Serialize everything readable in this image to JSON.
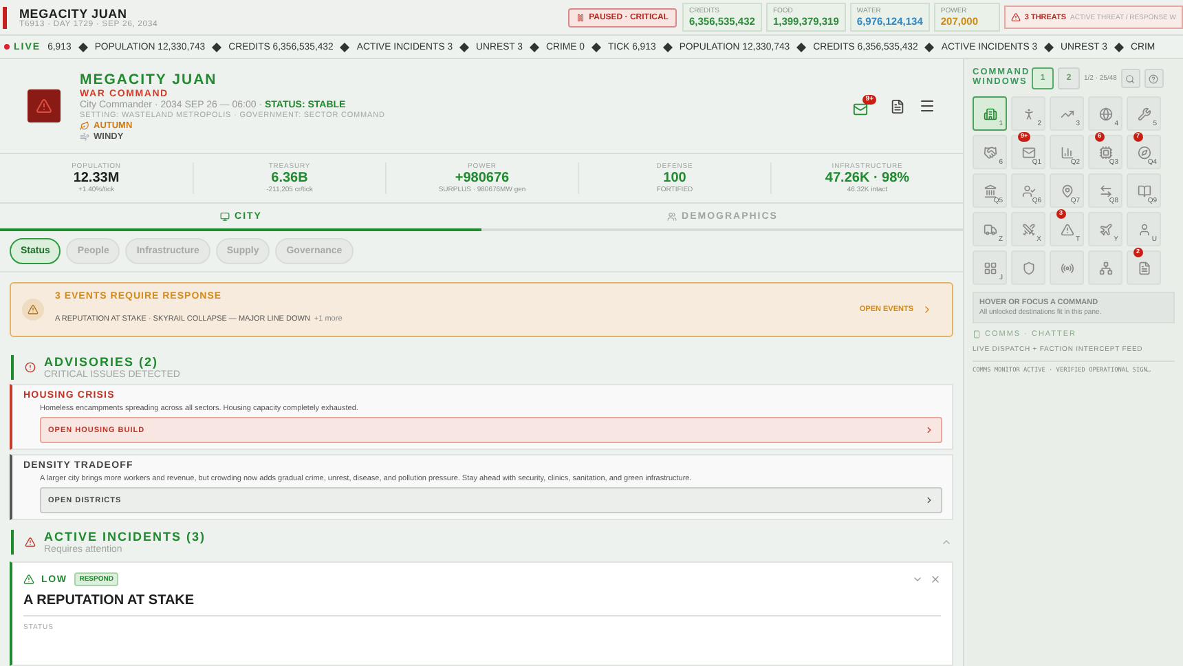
{
  "top_bar": {
    "title": "MEGACITY JUAN",
    "subtitle": "T6913 · DAY 1729 · SEP 26, 2034",
    "status": "PAUSED · CRITICAL",
    "resources": [
      {
        "label": "CREDITS",
        "value": "6,356,535,432",
        "color": "#2e8b3a"
      },
      {
        "label": "FOOD",
        "value": "1,399,379,319",
        "color": "#2e8b3a"
      },
      {
        "label": "WATER",
        "value": "6,976,124,134",
        "color": "#2f86c4"
      },
      {
        "label": "POWER",
        "value": "207,000",
        "color": "#d08a10"
      }
    ],
    "threats": {
      "label": "3 THREATS",
      "detail": "ACTIVE THREAT / RESPONSE W"
    }
  },
  "ticker": {
    "live": "LIVE",
    "items": [
      "6,913",
      "POPULATION 12,330,743",
      "CREDITS 6,356,535,432",
      "ACTIVE INCIDENTS 3",
      "UNREST 3",
      "CRIME 0",
      "TICK 6,913",
      "POPULATION 12,330,743",
      "CREDITS 6,356,535,432",
      "ACTIVE INCIDENTS 3",
      "UNREST 3",
      "CRIM"
    ]
  },
  "city": {
    "name": "MEGACITY JUAN",
    "faction": "WAR COMMAND",
    "role": "City Commander · 2034 SEP 26 — 06:00 · ",
    "status": "STATUS: STABLE",
    "setting": "SETTING: WASTELAND METROPOLIS · GOVERNMENT: SECTOR COMMAND",
    "season": "AUTUMN",
    "weather": "WINDY",
    "mail_badge": "9+"
  },
  "stats": [
    {
      "label": "POPULATION",
      "value": "12.33M",
      "sub": "+1.40%/tick",
      "color": "#1d1f1d"
    },
    {
      "label": "TREASURY",
      "value": "6.36B",
      "sub": "-211,205 cr/tick",
      "color": "#1f8a2e"
    },
    {
      "label": "POWER",
      "value": "+980676",
      "sub": "SURPLUS · 980676MW gen",
      "color": "#1f8a2e"
    },
    {
      "label": "DEFENSE",
      "value": "100",
      "sub": "FORTIFIED",
      "color": "#1f8a2e"
    },
    {
      "label": "INFRASTRUCTURE",
      "value": "47.26K · 98%",
      "sub": "46.32K intact",
      "color": "#1f8a2e"
    }
  ],
  "tabs": [
    {
      "label": "CITY",
      "selected": true
    },
    {
      "label": "DEMOGRAPHICS",
      "selected": false
    }
  ],
  "subtabs": [
    {
      "label": "Status",
      "selected": true
    },
    {
      "label": "People",
      "selected": false
    },
    {
      "label": "Infrastructure",
      "selected": false
    },
    {
      "label": "Supply",
      "selected": false
    },
    {
      "label": "Governance",
      "selected": false
    }
  ],
  "events_banner": {
    "title": "3 EVENTS REQUIRE RESPONSE",
    "detail": "A REPUTATION AT STAKE · SKYRAIL COLLAPSE — MAJOR LINE DOWN",
    "more": "+1 more",
    "action": "OPEN EVENTS"
  },
  "advisories": {
    "title": "ADVISORIES (2)",
    "subtitle": "CRITICAL ISSUES DETECTED",
    "items": [
      {
        "kind": "critical",
        "title": "HOUSING CRISIS",
        "text": "Homeless encampments spreading across all sectors. Housing capacity completely exhausted.",
        "action": "OPEN HOUSING BUILD"
      },
      {
        "kind": "info",
        "title": "DENSITY TRADEOFF",
        "text": "A larger city brings more workers and revenue, but crowding now adds gradual crime, unrest, disease, and pollution pressure. Stay ahead with security, clinics, sanitation, and green infrastructure.",
        "action": "OPEN DISTRICTS"
      }
    ]
  },
  "incidents": {
    "title": "ACTIVE INCIDENTS (3)",
    "subtitle": "Requires attention",
    "expanded": true,
    "items": [
      {
        "level": "LOW",
        "tag": "RESPOND",
        "title": "A REPUTATION AT STAKE",
        "section": "STATUS",
        "expanded": false
      }
    ]
  },
  "command_windows": {
    "title": "COMMAND WINDOWS",
    "pages": [
      {
        "label": "1",
        "selected": true
      },
      {
        "label": "2",
        "selected": false
      }
    ],
    "count": "1/2 · 25/48",
    "cells": [
      {
        "key": "1",
        "selected": true
      },
      {
        "key": "2",
        "selected": false
      },
      {
        "key": "3",
        "selected": false
      },
      {
        "key": "4",
        "selected": false
      },
      {
        "key": "5",
        "selected": false
      },
      {
        "key": "6",
        "selected": false
      },
      {
        "key": "Q1",
        "selected": false,
        "badge": "9+"
      },
      {
        "key": "Q2",
        "selected": false
      },
      {
        "key": "Q3",
        "selected": false,
        "badge": "6"
      },
      {
        "key": "Q4",
        "selected": false,
        "badge": "7"
      },
      {
        "key": "Q5",
        "selected": false
      },
      {
        "key": "Q6",
        "selected": false
      },
      {
        "key": "Q7",
        "selected": false
      },
      {
        "key": "Q8",
        "selected": false
      },
      {
        "key": "Q9",
        "selected": false
      },
      {
        "key": "Z",
        "selected": false
      },
      {
        "key": "X",
        "selected": false
      },
      {
        "key": "T",
        "selected": false,
        "badge": "3"
      },
      {
        "key": "Y",
        "selected": false
      },
      {
        "key": "U",
        "selected": false
      },
      {
        "key": "J",
        "selected": false
      },
      {
        "selected": false
      },
      {
        "selected": false
      },
      {
        "selected": false
      },
      {
        "selected": false,
        "badge": "2"
      }
    ],
    "hint_title": "HOVER OR FOCUS A COMMAND",
    "hint_text": "All unlocked destinations fit in this pane."
  },
  "comms": {
    "title": "COMMS · CHATTER",
    "subtitle": "LIVE DISPATCH + FACTION INTERCEPT FEED",
    "log": "COMMS MONITOR ACTIVE · VERIFIED OPERATIONAL SIGN…"
  }
}
